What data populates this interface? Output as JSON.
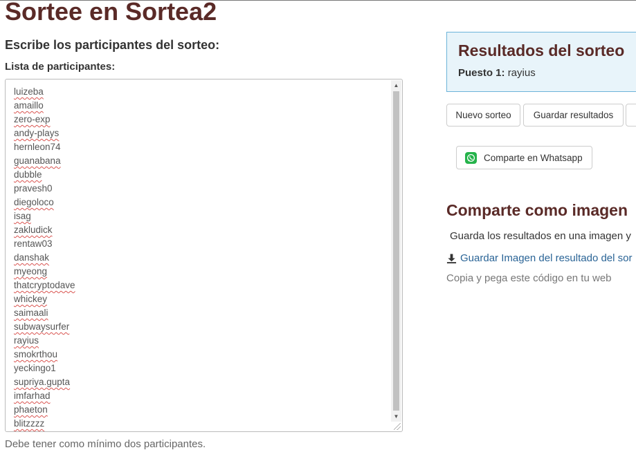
{
  "header": {
    "title": "Sortee en Sortea2"
  },
  "form": {
    "subtitle": "Escribe los participantes del sorteo:",
    "list_label": "Lista de participantes:",
    "participants": [
      {
        "name": "luizeba",
        "flagged": true
      },
      {
        "name": "amaillo",
        "flagged": true
      },
      {
        "name": "zero-exp",
        "flagged": true
      },
      {
        "name": "andy-plays",
        "flagged": true
      },
      {
        "name": "hernleon74",
        "flagged": false
      },
      {
        "name": "guanabana",
        "flagged": true
      },
      {
        "name": "dubble",
        "flagged": true
      },
      {
        "name": "pravesh0",
        "flagged": false
      },
      {
        "name": "diegoloco",
        "flagged": true
      },
      {
        "name": "isag",
        "flagged": true
      },
      {
        "name": "zakludick",
        "flagged": true
      },
      {
        "name": "rentaw03",
        "flagged": false
      },
      {
        "name": "danshak",
        "flagged": true
      },
      {
        "name": "myeong",
        "flagged": true
      },
      {
        "name": "thatcryptodave",
        "flagged": true
      },
      {
        "name": "whickey",
        "flagged": true
      },
      {
        "name": "saimaali",
        "flagged": true
      },
      {
        "name": "subwaysurfer",
        "flagged": true
      },
      {
        "name": "rayius",
        "flagged": true
      },
      {
        "name": "smokrthou",
        "flagged": true
      },
      {
        "name": "yeckingo1",
        "flagged": false
      },
      {
        "name": "supriya.gupta",
        "flagged": true
      },
      {
        "name": "imfarhad",
        "flagged": true
      },
      {
        "name": "phaeton",
        "flagged": true
      },
      {
        "name": "blitzzzz",
        "flagged": true
      }
    ],
    "hint": "Debe tener como mínimo dos participantes."
  },
  "results": {
    "title": "Resultados del sorteo",
    "position_label": "Puesto 1:",
    "winner": "rayius"
  },
  "actions": {
    "new_draw": "Nuevo sorteo",
    "save_results": "Guardar resultados",
    "whatsapp": "Comparte en Whatsapp"
  },
  "share": {
    "title": "Comparte como imagen",
    "description": "Guarda los resultados en una imagen y",
    "download_link": "Guardar Imagen del resultado del sor",
    "copy_note": "Copia y pega este código en tu web"
  },
  "colors": {
    "heading": "#5a2a27",
    "panel_bg": "#e8f4fa",
    "panel_border": "#6bb3d9",
    "link": "#2a6496",
    "whatsapp": "#25b34b"
  },
  "icons": {
    "whatsapp": "whatsapp-icon",
    "download": "download-icon"
  }
}
